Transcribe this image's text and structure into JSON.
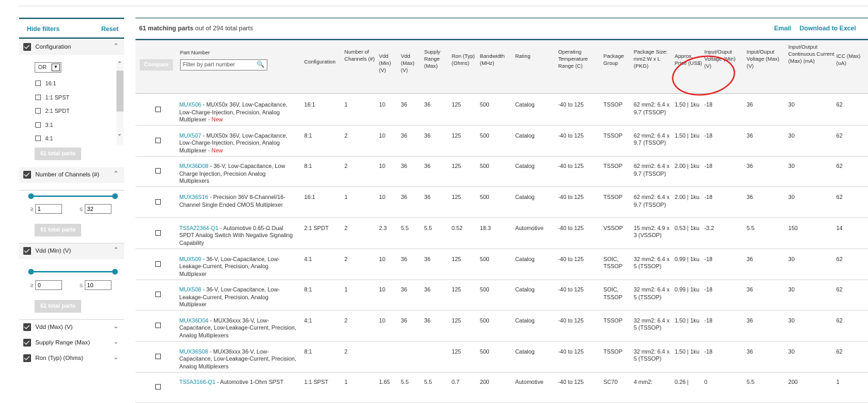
{
  "sidebar": {
    "hide_filters": "Hide filters",
    "reset": "Reset",
    "configuration": {
      "title": "Configuration",
      "logic": "OR",
      "options": [
        "16:1",
        "1:1 SPST",
        "2:1 SPDT",
        "3:1",
        "4:1"
      ],
      "button": "61 total parts"
    },
    "channels": {
      "title": "Number of Channels (#)",
      "min_label": "≥",
      "min": "1",
      "max_label": "≤",
      "max": "32",
      "button": "61 total parts"
    },
    "vdd_min": {
      "title": "Vdd (Min) (V)",
      "min_label": "≥",
      "min": "0",
      "max_label": "≤",
      "max": "10",
      "button": "61 total parts"
    },
    "collapsed": [
      "Vdd (Max) (V)",
      "Supply Range (Max)",
      "Ron (Typ) (Ohms)"
    ]
  },
  "main": {
    "count_bold": "61 matching parts",
    "count_rest": "out of 294 total parts",
    "email": "Email",
    "download": "Download to Excel",
    "compare": "Compare",
    "part_number_header": "Part Number",
    "filter_placeholder": "Filter by part number"
  },
  "headers": [
    "Configuration",
    "Number of Channels (#)",
    "Vdd (Min) (V)",
    "Vdd (Max) (V)",
    "Supply Range (Max)",
    "Ron (Typ) (Ohms)",
    "Bandwidth (MHz)",
    "Rating",
    "Operating Temperature Range (C)",
    "Package Group",
    "Package Size: mm2:W x L (PKG)",
    "Approx. Price (US$)",
    "Input/Ouput Voltage (Min) (V)",
    "Input/Ouput Voltage (Max) (V)",
    "Input/Output Continuous Current (Max) (mA)",
    "ICC (Max) (uA)"
  ],
  "rows": [
    {
      "part": "MUX506",
      "desc": " - MUX50x 36V, Low-Capacitance, Low-Charge-Injection, Precision, Analog Multiplexer",
      "new": " - New",
      "cfg": "16:1",
      "ch": "1",
      "vmin": "10",
      "vmax": "36",
      "sr": "36",
      "ron": "125",
      "bw": "500",
      "rating": "Catalog",
      "temp": "-40 to 125",
      "pkg": "TSSOP",
      "size": "62 mm2: 6.4 x 9.7 (TSSOP)",
      "price": "1.50 | 1ku",
      "iomin": "-18",
      "iomax": "36",
      "cur": "30",
      "icc": "62"
    },
    {
      "part": "MUX507",
      "desc": " - MUX50x 36V, Low-Capacitance, Low-Charge-Injection, Precision, Analog Multiplexer",
      "new": " - New",
      "cfg": "8:1",
      "ch": "2",
      "vmin": "10",
      "vmax": "36",
      "sr": "36",
      "ron": "125",
      "bw": "500",
      "rating": "Catalog",
      "temp": "-40 to 125",
      "pkg": "TSSOP",
      "size": "62 mm2: 6.4 x 9.7 (TSSOP)",
      "price": "1.50 | 1ku",
      "iomin": "-18",
      "iomax": "36",
      "cur": "30",
      "icc": "62"
    },
    {
      "part": "MUX36D08",
      "desc": " - 36-V, Low-Capacitance, Low Charge Injection, Precision Analog Multiplexers",
      "new": "",
      "cfg": "8:1",
      "ch": "2",
      "vmin": "10",
      "vmax": "36",
      "sr": "36",
      "ron": "125",
      "bw": "500",
      "rating": "Catalog",
      "temp": "-40 to 125",
      "pkg": "TSSOP",
      "size": "62 mm2: 6.4 x 9.7 (TSSOP)",
      "price": "2.00 | 1ku",
      "iomin": "-18",
      "iomax": "36",
      "cur": "30",
      "icc": "62"
    },
    {
      "part": "MUX36S16",
      "desc": " - Precision 36V 8-Channel/16-Channel Single Ended CMOS Multiplexer",
      "new": "",
      "cfg": "16:1",
      "ch": "1",
      "vmin": "10",
      "vmax": "36",
      "sr": "36",
      "ron": "125",
      "bw": "500",
      "rating": "Catalog",
      "temp": "-40 to 125",
      "pkg": "TSSOP",
      "size": "62 mm2: 6.4 x 9.7 (TSSOP)",
      "price": "2.00 | 1ku",
      "iomin": "-18",
      "iomax": "36",
      "cur": "30",
      "icc": "62"
    },
    {
      "part": "TS5A22364-Q1",
      "desc": " - Automotive 0.65-Ω Dual SPDT Analog Switch With Negative Signaling Capability",
      "new": "",
      "cfg": "2:1 SPDT",
      "ch": "2",
      "vmin": "2.3",
      "vmax": "5.5",
      "sr": "5.5",
      "ron": "0.52",
      "bw": "18.3",
      "rating": "Automotive",
      "temp": "-40 to 125",
      "pkg": "VSSOP",
      "size": "15 mm2: 4.9 x 3 (VSSOP)",
      "price": "0.53 | 1ku",
      "iomin": "-3.2",
      "iomax": "5.5",
      "cur": "150",
      "icc": "14"
    },
    {
      "part": "MUX509",
      "desc": " - 36-V, Low-Capacitance, Low-Leakage-Current, Precision, Analog Multiplexer",
      "new": "",
      "cfg": "4:1",
      "ch": "2",
      "vmin": "10",
      "vmax": "36",
      "sr": "36",
      "ron": "125",
      "bw": "500",
      "rating": "Catalog",
      "temp": "-40 to 125",
      "pkg": "SOIC, TSSOP",
      "size": "32 mm2: 6.4 x 5 (TSSOP)",
      "price": "0.99 | 1ku",
      "iomin": "-18",
      "iomax": "36",
      "cur": "30",
      "icc": "62"
    },
    {
      "part": "MUX508",
      "desc": " - 36-V, Low-Capacitance, Low-Leakage-Current, Precision, Analog Multiplexer",
      "new": "",
      "cfg": "8:1",
      "ch": "1",
      "vmin": "10",
      "vmax": "36",
      "sr": "36",
      "ron": "125",
      "bw": "500",
      "rating": "Catalog",
      "temp": "-40 to 125",
      "pkg": "SOIC, TSSOP",
      "size": "32 mm2: 6.4 x 5 (TSSOP)",
      "price": "0.99 | 1ku",
      "iomin": "-18",
      "iomax": "36",
      "cur": "30",
      "icc": "62"
    },
    {
      "part": "MUX36D04",
      "desc": " - MUX36xxx 36-V, Low-Capacitance, Low-Leakage-Current, Precision, Analog Multiplexers",
      "new": "",
      "cfg": "4:1",
      "ch": "2",
      "vmin": "10",
      "vmax": "36",
      "sr": "36",
      "ron": "125",
      "bw": "500",
      "rating": "Catalog",
      "temp": "-40 to 125",
      "pkg": "TSSOP",
      "size": "32 mm2: 6.4 x 5 (TSSOP)",
      "price": "1.50 | 1ku",
      "iomin": "-18",
      "iomax": "36",
      "cur": "30",
      "icc": "62"
    },
    {
      "part": "MUX36S08",
      "desc": " - MUX36xxx 36-V, Low-Capacitance, Low-Leakage-Current, Precision, Analog Multiplexers",
      "new": "",
      "cfg": "8:1",
      "ch": "2",
      "vmin": "",
      "vmax": "",
      "sr": "",
      "ron": "125",
      "bw": "500",
      "rating": "Catalog",
      "temp": "-40 to 125",
      "pkg": "TSSOP",
      "size": "32 mm2: 6.4 x 5 (TSSOP)",
      "price": "1.50 | 1ku",
      "iomin": "-18",
      "iomax": "36",
      "cur": "30",
      "icc": "62"
    },
    {
      "part": "TS5A3166-Q1",
      "desc": " - Automotive 1-Ohm SPST",
      "new": "",
      "cfg": "1:1 SPST",
      "ch": "1",
      "vmin": "1.65",
      "vmax": "5.5",
      "sr": "5.5",
      "ron": "0.7",
      "bw": "200",
      "rating": "Automotive",
      "temp": "-40 to 125",
      "pkg": "SC70",
      "size": "4 mm2:",
      "price": "0.26 |",
      "iomin": "0",
      "iomax": "5.5",
      "cur": "200",
      "icc": "1"
    }
  ]
}
